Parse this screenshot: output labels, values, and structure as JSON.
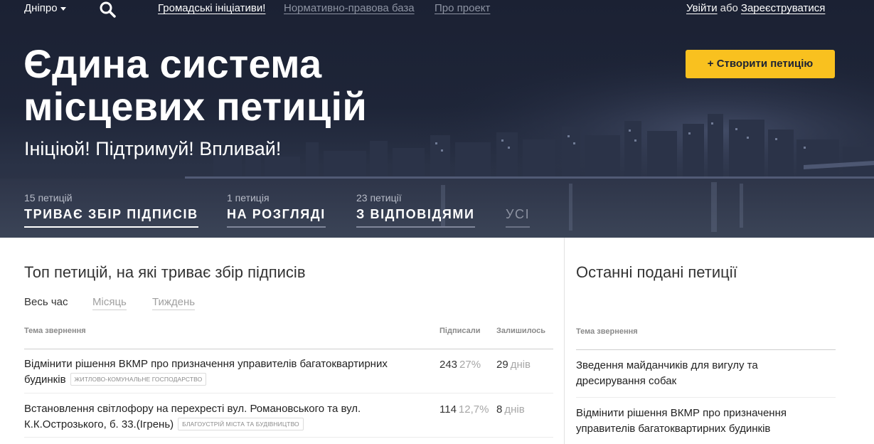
{
  "header": {
    "city": "Дніпро",
    "nav": [
      "Громадські ініціативи!",
      "Нормативно-правова база",
      "Про проект"
    ],
    "login": "Увійти",
    "or": "або",
    "register": "Зареєструватися"
  },
  "hero": {
    "title_line1": "Єдина система",
    "title_line2": "місцевих петицій",
    "subtitle": "Ініціюй! Підтримуй! Впливай!",
    "create_button": "+ Створити петицію"
  },
  "filters": [
    {
      "count": "15 петицій",
      "label": "ТРИВАЄ ЗБІР ПІДПИСІВ"
    },
    {
      "count": "1 петиція",
      "label": "НА РОЗГЛЯДІ"
    },
    {
      "count": "23 петиції",
      "label": "З ВІДПОВІДЯМИ"
    },
    {
      "count": "",
      "label": "УСІ"
    }
  ],
  "top": {
    "title": "Топ петицій, на які триває збір підписів",
    "periods": [
      "Весь час",
      "Місяць",
      "Тиждень"
    ],
    "headers": {
      "topic": "Тема звернення",
      "signed": "Підписали",
      "remaining": "Залишилось"
    },
    "rows": [
      {
        "title_line1": "Відмінити рішення ВКМР про призначення управителів багатоквартирних",
        "title_line2": "будинків",
        "tag": "ЖИТЛОВО-КОМУНАЛЬНЕ ГОСПОДАРСТВО",
        "signed": "243",
        "percent": "27%",
        "remaining": "29",
        "unit": "днів"
      },
      {
        "title_line1": "Встановлення світлофору на перехресті вул. Романовського та вул.",
        "title_line2": "К.К.Острозького, б. 33.(Ігрень)",
        "tag": "БЛАГОУСТРІЙ МІСТА ТА БУДІВНИЦТВО",
        "signed": "114",
        "percent": "12,7%",
        "remaining": "8",
        "unit": "днів"
      }
    ]
  },
  "recent": {
    "title": "Останні подані петиції",
    "header": "Тема звернення",
    "rows": [
      {
        "line1": "Зведення майданчиків для вигулу та",
        "line2": "дресирування собак"
      },
      {
        "line1": "Відмінити рішення ВКМР про призначення",
        "line2": "управителів багатоквартирних будинків"
      }
    ]
  },
  "colors": {
    "accent": "#f9c11f",
    "hero_bg": "#1e2538"
  }
}
